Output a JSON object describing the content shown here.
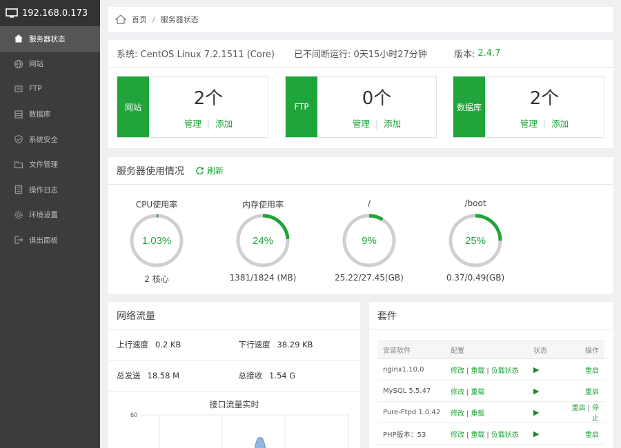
{
  "sidebar": {
    "host": "192.168.0.173",
    "items": [
      {
        "label": "服务器状态",
        "icon": "home-icon",
        "active": true
      },
      {
        "label": "网站",
        "icon": "globe-icon"
      },
      {
        "label": "FTP",
        "icon": "ftp-icon"
      },
      {
        "label": "数据库",
        "icon": "database-icon"
      },
      {
        "label": "系统安全",
        "icon": "shield-icon"
      },
      {
        "label": "文件管理",
        "icon": "folder-icon"
      },
      {
        "label": "操作日志",
        "icon": "log-icon"
      },
      {
        "label": "环境设置",
        "icon": "gear-icon"
      },
      {
        "label": "退出面板",
        "icon": "logout-icon"
      }
    ]
  },
  "breadcrumb": {
    "home": "首页",
    "current": "服务器状态"
  },
  "sysinfo": {
    "system": "系统: CentOS Linux 7.2.1511 (Core)",
    "uptime": "已不间断运行: 0天15小时27分钟",
    "version_label": "版本:",
    "version": "2.4.7"
  },
  "cards": [
    {
      "tag": "网站",
      "count": "2个",
      "manage": "管理",
      "add": "添加"
    },
    {
      "tag": "FTP",
      "count": "0个",
      "manage": "管理",
      "add": "添加"
    },
    {
      "tag": "数据库",
      "count": "2个",
      "manage": "管理",
      "add": "添加"
    }
  ],
  "usage": {
    "title": "服务器使用情况",
    "refresh": "刷新",
    "gauges": [
      {
        "title": "CPU使用率",
        "value": "1.03%",
        "fraction": 0.0103,
        "detail": "2 核心"
      },
      {
        "title": "内存使用率",
        "value": "24%",
        "fraction": 0.24,
        "detail": "1381/1824 (MB)"
      },
      {
        "title": "/",
        "value": "9%",
        "fraction": 0.09,
        "detail": "25.22/27.45(GB)"
      },
      {
        "title": "/boot",
        "value": "25%",
        "fraction": 0.25,
        "detail": "0.37/0.49(GB)"
      }
    ]
  },
  "network": {
    "title": "网络流量",
    "up_label": "上行速度",
    "up_value": "0.2 KB",
    "down_label": "下行速度",
    "down_value": "38.29 KB",
    "sent_label": "总发送",
    "sent_value": "18.58 M",
    "recv_label": "总接收",
    "recv_value": "1.54 G",
    "chart_title": "接口流量实时",
    "y_tick": "60"
  },
  "suite": {
    "title": "套件",
    "headers": [
      "安装软件",
      "配置",
      "状态",
      "操作"
    ],
    "rows": [
      {
        "name": "nginx1.10.0",
        "config": [
          "修改",
          "重载",
          "负载状态"
        ],
        "ops": [
          "重启"
        ]
      },
      {
        "name": "MySQL 5.5.47",
        "config": [
          "修改",
          "重载"
        ],
        "ops": [
          "重启"
        ]
      },
      {
        "name": "Pure-Ftpd 1.0.42",
        "config": [
          "修改",
          "重载"
        ],
        "ops": [
          "重启",
          "停止"
        ]
      },
      {
        "name": "PHP版本：53",
        "config": [
          "修改",
          "重载",
          "负载状态"
        ],
        "ops": [
          "重启"
        ]
      }
    ]
  },
  "colors": {
    "accent": "#20a53a",
    "sidebar_bg": "#3c3c3c",
    "sidebar_active": "#555555"
  }
}
